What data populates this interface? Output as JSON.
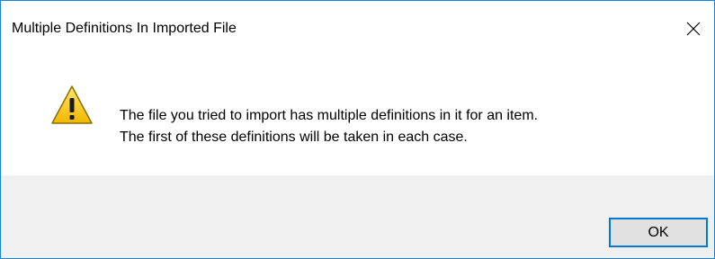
{
  "window": {
    "title": "Multiple Definitions In Imported File",
    "close_icon": "close-icon"
  },
  "message": {
    "icon": "warning-icon",
    "line1": "The file you tried to import has multiple definitions in it for an item.",
    "line2": "The first of these definitions will be taken in each case."
  },
  "buttons": {
    "ok_label": "OK"
  },
  "colors": {
    "accent": "#0078d7",
    "window_border": "#1883d7",
    "footer_bg": "#f0f0f0",
    "button_bg": "#e1e1e1",
    "warning_yellow": "#f7c600"
  }
}
